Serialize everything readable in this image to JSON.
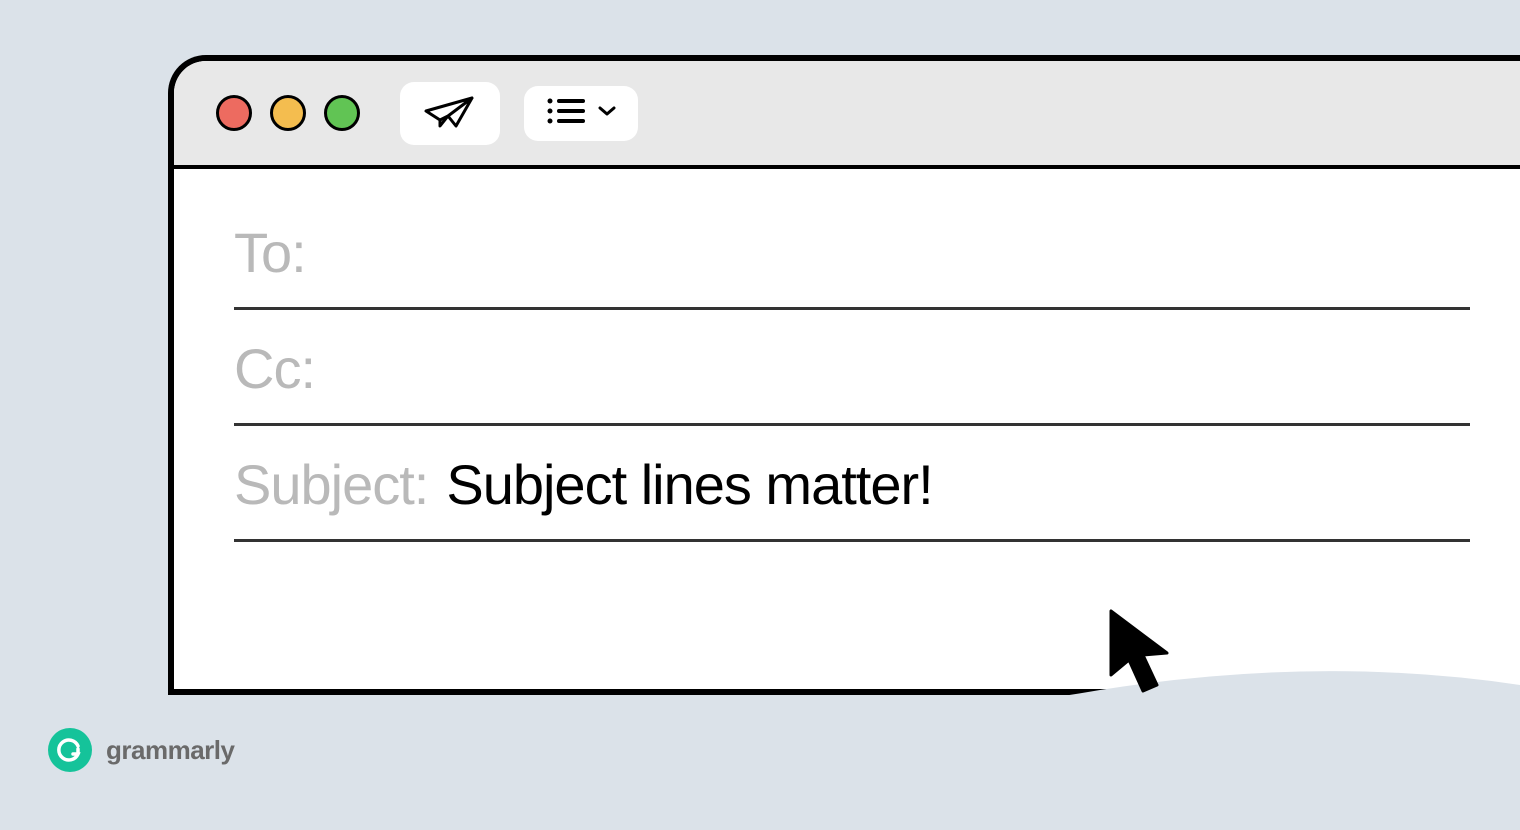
{
  "brand": {
    "name": "grammarly"
  },
  "compose": {
    "to_label": "To:",
    "to_value": "",
    "cc_label": "Cc:",
    "cc_value": "",
    "subject_label": "Subject:",
    "subject_value": "Subject lines matter!"
  },
  "colors": {
    "background": "#dbe2e9",
    "brand_green": "#15c39a",
    "label_gray": "#b9b9b9"
  },
  "icons": {
    "send": "paper-plane-icon",
    "list": "list-icon",
    "dropdown": "chevron-down-icon",
    "cursor": "cursor-icon"
  }
}
